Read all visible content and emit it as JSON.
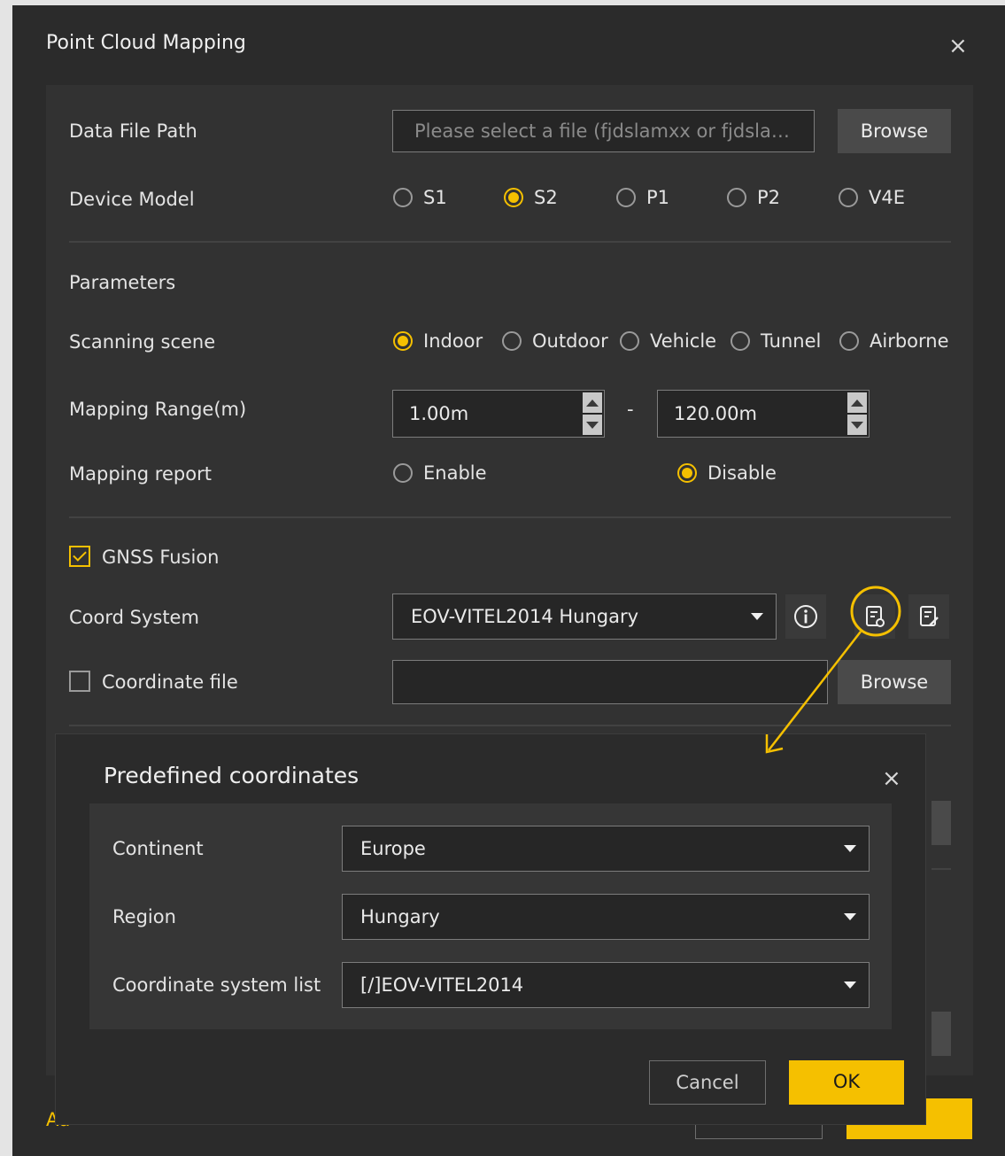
{
  "dialog": {
    "title": "Point Cloud Mapping",
    "close_glyph": "×"
  },
  "data_file": {
    "label": "Data File Path",
    "placeholder": "Please select a file (fjdslamxx or fjdslam…",
    "browse": "Browse"
  },
  "device_model": {
    "label": "Device Model",
    "options": [
      "S1",
      "S2",
      "P1",
      "P2",
      "V4E"
    ],
    "selected": "S2"
  },
  "parameters": {
    "heading": "Parameters",
    "scanning_scene": {
      "label": "Scanning scene",
      "options": [
        "Indoor",
        "Outdoor",
        "Vehicle",
        "Tunnel",
        "Airborne"
      ],
      "selected": "Indoor"
    },
    "mapping_range": {
      "label": "Mapping Range(m)",
      "min": "1.00m",
      "dash": "-",
      "max": "120.00m"
    },
    "mapping_report": {
      "label": "Mapping report",
      "options": [
        "Enable",
        "Disable"
      ],
      "selected": "Disable"
    }
  },
  "gnss": {
    "fusion_label": "GNSS Fusion",
    "fusion_checked": true,
    "coord_system_label": "Coord System",
    "coord_system_value": "EOV-VITEL2014 Hungary",
    "coord_file_label": "Coordinate file",
    "coord_file_checked": false,
    "coord_file_value": "",
    "browse": "Browse"
  },
  "footer": {
    "partial_text": "Ad"
  },
  "predefined_modal": {
    "title": "Predefined coordinates",
    "close_glyph": "×",
    "continent_label": "Continent",
    "continent_value": "Europe",
    "region_label": "Region",
    "region_value": "Hungary",
    "coord_list_label": "Coordinate system list",
    "coord_list_value": "[/]EOV-VITEL2014",
    "cancel": "Cancel",
    "ok": "OK"
  },
  "colors": {
    "accent": "#f5c000",
    "dialog_bg": "#2b2b2b",
    "panel_bg": "#323232",
    "annotation": "#f5c000"
  },
  "icons": [
    "close-icon",
    "info-icon",
    "predefined-coords-icon",
    "edit-coords-icon",
    "dropdown-caret-icon",
    "spin-up-icon",
    "spin-down-icon",
    "annotation-arrow-icon"
  ]
}
